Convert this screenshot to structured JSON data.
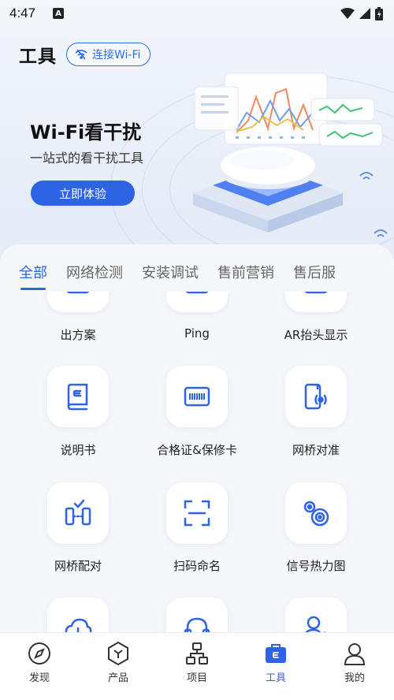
{
  "status_bar": {
    "time": "4:47",
    "app_badge": "A"
  },
  "header": {
    "title": "工具",
    "wifi_button": "连接Wi-Fi"
  },
  "banner": {
    "title": "Wi-Fi看干扰",
    "subtitle": "一站式的看干扰工具",
    "cta": "立即体验"
  },
  "tabs": [
    {
      "label": "全部",
      "active": true
    },
    {
      "label": "网络检测"
    },
    {
      "label": "安装调试"
    },
    {
      "label": "售前营销"
    },
    {
      "label": "售后服"
    }
  ],
  "tools": [
    {
      "label": "出方案",
      "icon": "plan-icon"
    },
    {
      "label": "Ping",
      "icon": "ping-icon"
    },
    {
      "label": "AR抬头显示",
      "icon": "ar-icon"
    },
    {
      "label": "说明书",
      "icon": "manual-icon"
    },
    {
      "label": "合格证&保修卡",
      "icon": "certificate-icon"
    },
    {
      "label": "网桥对准",
      "icon": "bridge-align-icon"
    },
    {
      "label": "网桥配对",
      "icon": "bridge-pair-icon"
    },
    {
      "label": "扫码命名",
      "icon": "scan-icon"
    },
    {
      "label": "信号热力图",
      "icon": "heatmap-icon"
    },
    {
      "label": "",
      "icon": "cloud-icon"
    },
    {
      "label": "",
      "icon": "headset-icon"
    },
    {
      "label": "",
      "icon": "engineer-icon"
    }
  ],
  "bottom_nav": [
    {
      "label": "发现",
      "icon": "compass-icon"
    },
    {
      "label": "产品",
      "icon": "product-icon"
    },
    {
      "label": "项目",
      "icon": "project-icon"
    },
    {
      "label": "工具",
      "icon": "toolbox-icon",
      "active": true
    },
    {
      "label": "我的",
      "icon": "user-icon"
    }
  ],
  "colors": {
    "accent": "#2e63e3",
    "background": "#eef2f8"
  }
}
